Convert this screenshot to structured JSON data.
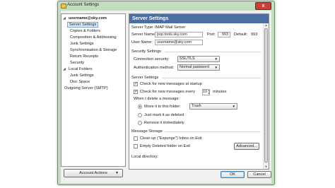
{
  "window": {
    "title": "Account Settings",
    "close_label": "x"
  },
  "tree": {
    "items": [
      {
        "label": "username@sky.com",
        "bold": true,
        "twisty": "◢"
      },
      {
        "label": "Server Settings",
        "selected": true
      },
      {
        "label": "Copies & Folders"
      },
      {
        "label": "Composition & Addressing"
      },
      {
        "label": "Junk Settings"
      },
      {
        "label": "Synchronisation & Storage"
      },
      {
        "label": "Return Receipts"
      },
      {
        "label": "Security"
      },
      {
        "label": "Local Folders",
        "twisty": "◢"
      },
      {
        "label": "Junk Settings"
      },
      {
        "label": "Disc Space"
      },
      {
        "label": "Outgoing Server (SMTP)"
      }
    ],
    "account_actions": "Account Actions"
  },
  "panel": {
    "title": "Server Settings",
    "server_type_label": "Server Type:",
    "server_type_value": "IMAP Mail Server",
    "server_name_label": "Server Name:",
    "server_name_value": "pop.tools.sky.com",
    "port_label": "Port:",
    "port_value": "993",
    "default_label": "Default:",
    "default_value": "993",
    "user_name_label": "User Name:",
    "user_name_value": "username@sky.com",
    "security_heading": "Security Settings",
    "conn_security_label": "Connection security:",
    "conn_security_value": "SSL/TLS",
    "auth_method_label": "Authentication method:",
    "auth_method_value": "Normal password",
    "server_heading": "Server Settings",
    "check_startup_label": "Check for new messages at startup",
    "check_every_label": "Check for new messages every",
    "check_every_value": "10",
    "minutes_label": "minutes",
    "delete_label": "When I delete a message:",
    "move_label": "Move it to this folder:",
    "trash_value": "Trash",
    "mark_deleted_label": "Just mark it as deleted",
    "remove_label": "Remove it immediately",
    "storage_heading": "Message Storage",
    "cleanup_label": "Clean up (\"Expunge\") Inbox on Exit",
    "empty_deleted_label": "Empty Deleted folder on Exit",
    "advanced_label": "Advanced...",
    "local_dir_label": "Local directory:"
  },
  "footer": {
    "ok_label": "OK",
    "cancel_label": "Cancel"
  }
}
